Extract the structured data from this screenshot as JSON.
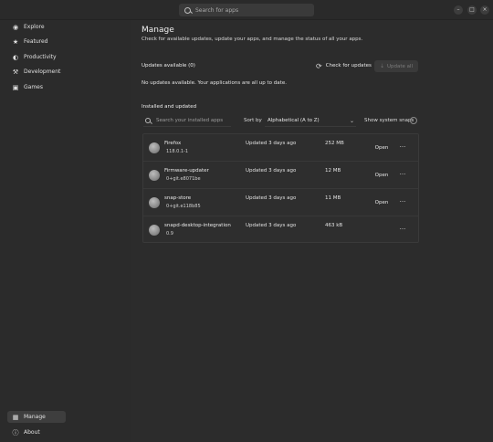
{
  "header": {
    "search_placeholder": "Search for apps",
    "buttons": [
      {
        "name": "minimize-button",
        "glyph": "–"
      },
      {
        "name": "maximize-button",
        "glyph": "□"
      },
      {
        "name": "close-button",
        "glyph": "×"
      }
    ]
  },
  "sidebar": {
    "items": [
      {
        "label": "Explore",
        "icon": "compass-icon",
        "glyph": "◉"
      },
      {
        "label": "Featured",
        "icon": "star-icon",
        "glyph": "★"
      },
      {
        "label": "Productivity",
        "icon": "bulb-icon",
        "glyph": "◐"
      },
      {
        "label": "Development",
        "icon": "wrench-icon",
        "glyph": "⚒"
      },
      {
        "label": "Games",
        "icon": "gamepad-icon",
        "glyph": "▣"
      }
    ],
    "bottom": [
      {
        "label": "Manage",
        "icon": "grid-icon",
        "glyph": "▦"
      },
      {
        "label": "About",
        "icon": "info-icon",
        "glyph": "ⓘ"
      }
    ]
  },
  "main": {
    "title": "Manage",
    "subtitle": "Check for available updates, update your apps, and manage the status of all your apps.",
    "updates_title": "Updates available (0)",
    "check_label": "Check for updates",
    "update_all_label": "Update all",
    "no_updates": "No updates available. Your applications are all up to date.",
    "installed_title": "Installed and updated",
    "filter_placeholder": "Search your installed apps",
    "sort_label": "Sort by",
    "sort_value": "Alphabetical (A to Z)",
    "show_system_label": "Show system snaps",
    "open_label": "Open",
    "more_label": "···",
    "apps": [
      {
        "name": "Firefox",
        "version": "118.0.1-1",
        "updated": "Updated 3 days ago",
        "size": "252 MB",
        "has_open": true
      },
      {
        "name": "Firmware-updater",
        "version": "0+git.e8071be",
        "updated": "Updated 3 days ago",
        "size": "12 MB",
        "has_open": true
      },
      {
        "name": "snap-store",
        "version": "0+git.e118b85",
        "updated": "Updated 3 days ago",
        "size": "11 MB",
        "has_open": true
      },
      {
        "name": "snapd-desktop-integration",
        "version": "0.9",
        "updated": "Updated 3 days ago",
        "size": "463 kB",
        "has_open": false
      }
    ]
  },
  "colors": {
    "background": "#2c2c2c",
    "sidebar": "#2b2b2b",
    "active_item": "#3e3e3e",
    "accent_window": "#a8422d"
  }
}
